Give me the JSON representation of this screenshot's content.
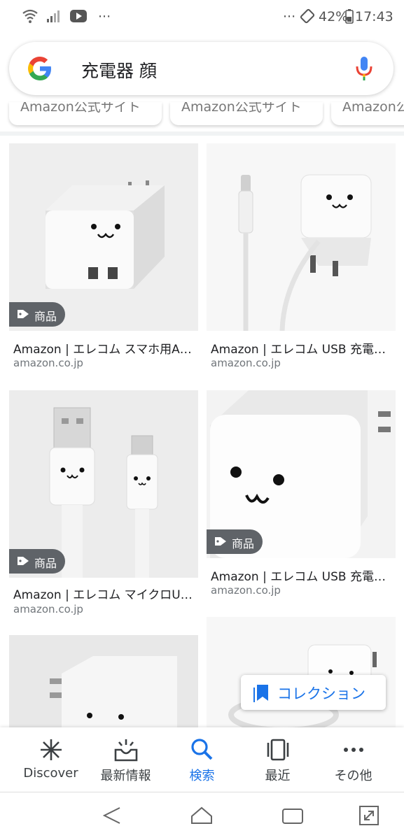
{
  "status_bar": {
    "battery": "42%",
    "time": "17:43",
    "more": "···"
  },
  "search": {
    "query": "充電器 顔"
  },
  "chips": [
    "Amazon公式サイト",
    "Amazon公式サイト",
    "Amazon公"
  ],
  "results": [
    {
      "title": "Amazon | エレコム スマホ用A…",
      "domain": "amazon.co.jp",
      "badge": "商品"
    },
    {
      "title": "Amazon | エレコム USB 充電…",
      "domain": "amazon.co.jp",
      "badge": ""
    },
    {
      "title": "Amazon | エレコム マイクロU…",
      "domain": "amazon.co.jp",
      "badge": "商品"
    },
    {
      "title": "Amazon | エレコム USB 充電…",
      "domain": "amazon.co.jp",
      "badge": "商品"
    }
  ],
  "collection_button": "コレクション",
  "bottom_nav": [
    {
      "label": "Discover",
      "icon": "asterisk-icon"
    },
    {
      "label": "最新情報",
      "icon": "inbox-icon"
    },
    {
      "label": "検索",
      "icon": "search-icon",
      "active": true
    },
    {
      "label": "最近",
      "icon": "recent-cards-icon"
    },
    {
      "label": "その他",
      "icon": "more-dots-icon"
    }
  ],
  "colors": {
    "accent": "#1a73e8",
    "badge_bg": "#5f6368",
    "text": "#202124",
    "domain": "#70757a"
  }
}
